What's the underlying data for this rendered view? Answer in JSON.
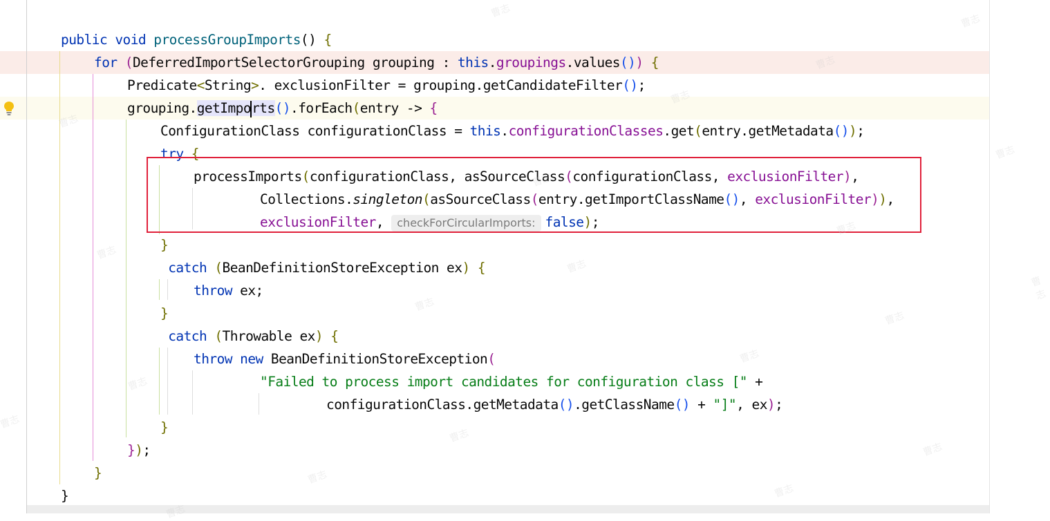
{
  "editor": {
    "hint_label": "checkForCircularImports:",
    "lines": [
      [
        [
          "kw",
          "public void "
        ],
        [
          "fn",
          "processGroupImports"
        ],
        [
          "",
          "() "
        ],
        [
          "brk",
          "{"
        ]
      ],
      [
        [
          "kw",
          "for "
        ],
        [
          "brk2",
          "("
        ],
        [
          "",
          "DeferredImportSelectorGrouping grouping : "
        ],
        [
          "kw",
          "this"
        ],
        [
          "",
          "."
        ],
        [
          "fld",
          "groupings"
        ],
        [
          "",
          "."
        ],
        [
          "",
          "values"
        ],
        [
          "brk3",
          "()"
        ],
        [
          "brk2",
          ")"
        ],
        [
          "brk",
          " {"
        ]
      ],
      [
        [
          "",
          "Predicate"
        ],
        [
          "brk",
          "<"
        ],
        [
          "",
          "String"
        ],
        [
          "brk",
          ">"
        ],
        [
          "",
          ". exclusionFilter = grouping.getCandidateFilter"
        ],
        [
          "brk3",
          "()"
        ],
        [
          "",
          ";"
        ]
      ],
      [
        [
          "",
          "grouping."
        ],
        [
          "hl",
          "getImpo"
        ],
        [
          "caret",
          ""
        ],
        [
          "hl",
          "rts"
        ],
        [
          "brk3",
          "()"
        ],
        [
          "",
          ".forEach"
        ],
        [
          "brk",
          "("
        ],
        [
          "",
          "entry -> "
        ],
        [
          "brk2",
          "{"
        ]
      ],
      [
        [
          "",
          "ConfigurationClass configurationClass = "
        ],
        [
          "kw",
          "this"
        ],
        [
          "",
          "."
        ],
        [
          "fld",
          "configurationClasses"
        ],
        [
          "",
          ".get"
        ],
        [
          "brk",
          "("
        ],
        [
          "",
          "entry.getMetadata"
        ],
        [
          "brk3",
          "()"
        ],
        [
          "brk",
          ")"
        ],
        [
          "",
          ";"
        ]
      ],
      [
        [
          "kw",
          "try "
        ],
        [
          "brk",
          "{"
        ]
      ],
      [
        [
          "",
          "processImports"
        ],
        [
          "brk",
          "("
        ],
        [
          "",
          "configurationClass, asSourceClass"
        ],
        [
          "brk2",
          "("
        ],
        [
          "",
          "configurationClass, "
        ],
        [
          "fld",
          "exclusionFilter"
        ],
        [
          "brk2",
          ")"
        ],
        [
          "",
          ","
        ]
      ],
      [
        [
          "",
          "Collections."
        ],
        [
          "it",
          "singleton"
        ],
        [
          "brk",
          "("
        ],
        [
          "",
          "asSourceClass"
        ],
        [
          "brk2",
          "("
        ],
        [
          "",
          "entry.getImportClassName"
        ],
        [
          "brk3",
          "()"
        ],
        [
          "",
          ", "
        ],
        [
          "fld",
          "exclusionFilter"
        ],
        [
          "brk2",
          ")"
        ],
        [
          "brk",
          ")"
        ],
        [
          "",
          ","
        ]
      ],
      [
        [
          "fld",
          "exclusionFilter"
        ],
        [
          "",
          ", "
        ],
        [
          "hint",
          ""
        ],
        [
          "kw",
          "false"
        ],
        [
          "brk",
          ")"
        ],
        [
          "",
          ";"
        ]
      ],
      [
        [
          "brk",
          "}"
        ]
      ],
      [
        [
          "kw",
          " catch "
        ],
        [
          "brk",
          "("
        ],
        [
          "",
          "BeanDefinitionStoreException ex"
        ],
        [
          "brk",
          ")"
        ],
        [
          "brk",
          " {"
        ]
      ],
      [
        [
          "kw",
          "throw "
        ],
        [
          "",
          "ex;"
        ]
      ],
      [
        [
          "brk",
          "}"
        ]
      ],
      [
        [
          "kw",
          " catch "
        ],
        [
          "brk",
          "("
        ],
        [
          "",
          "Throwable ex"
        ],
        [
          "brk",
          ")"
        ],
        [
          "brk",
          " {"
        ]
      ],
      [
        [
          "kw",
          "throw new "
        ],
        [
          "",
          "BeanDefinitionStoreException"
        ],
        [
          "brk2",
          "("
        ]
      ],
      [
        [
          "str",
          "\"Failed to process import candidates for configuration class [\""
        ],
        [
          "",
          " +"
        ]
      ],
      [
        [
          "",
          "configurationClass.getMetadata"
        ],
        [
          "brk3",
          "()"
        ],
        [
          "",
          ".getClassName"
        ],
        [
          "brk3",
          "()"
        ],
        [
          "",
          " + "
        ],
        [
          "str",
          "\"]\""
        ],
        [
          "",
          ", ex"
        ],
        [
          "brk2",
          ")"
        ],
        [
          "",
          ";"
        ]
      ],
      [
        [
          "brk",
          "}"
        ]
      ],
      [
        [
          "brk2",
          "}"
        ],
        [
          "brk",
          ")"
        ],
        [
          "",
          ";"
        ]
      ],
      [
        [
          "brk",
          "}"
        ]
      ],
      [
        [
          "",
          "}"
        ]
      ]
    ]
  },
  "watermark_text": "曹志"
}
